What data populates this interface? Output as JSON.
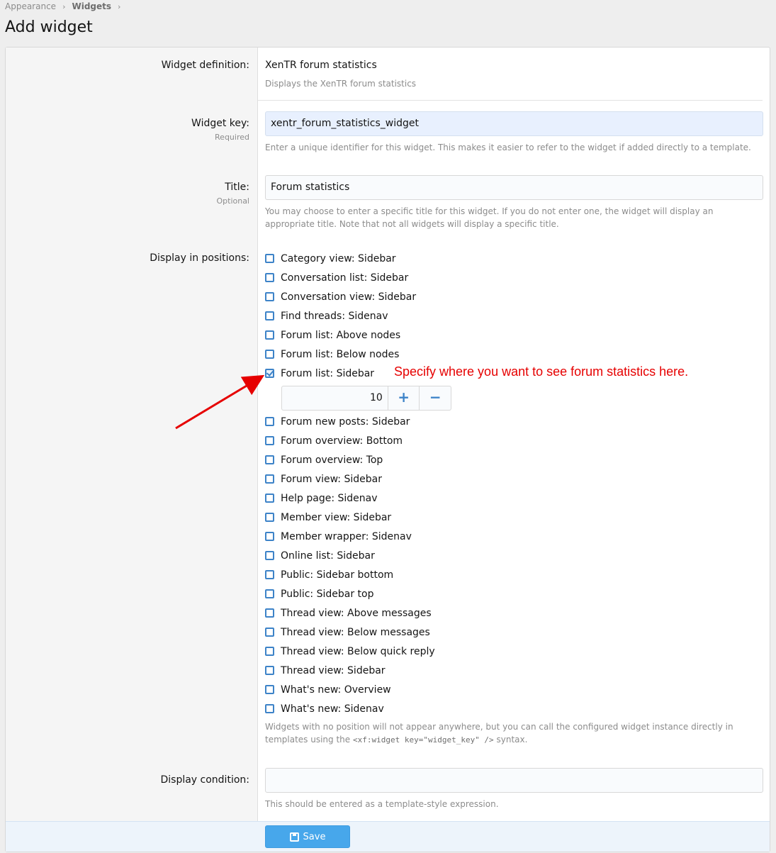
{
  "breadcrumb": {
    "items": [
      "Appearance",
      "Widgets"
    ],
    "separator": "›"
  },
  "page": {
    "title": "Add widget"
  },
  "form": {
    "definition": {
      "label": "Widget definition:",
      "value": "XenTR forum statistics",
      "explain": "Displays the XenTR forum statistics"
    },
    "key": {
      "label": "Widget key:",
      "hint": "Required",
      "value": "xentr_forum_statistics_widget",
      "explain": "Enter a unique identifier for this widget. This makes it easier to refer to the widget if added directly to a template."
    },
    "title": {
      "label": "Title:",
      "hint": "Optional",
      "value": "Forum statistics",
      "explain": "You may choose to enter a specific title for this widget. If you do not enter one, the widget will display an appropriate title. Note that not all widgets will display a specific title."
    },
    "positions": {
      "label": "Display in positions:",
      "items": [
        {
          "label": "Category view: Sidebar",
          "checked": false
        },
        {
          "label": "Conversation list: Sidebar",
          "checked": false
        },
        {
          "label": "Conversation view: Sidebar",
          "checked": false
        },
        {
          "label": "Find threads: Sidenav",
          "checked": false
        },
        {
          "label": "Forum list: Above nodes",
          "checked": false
        },
        {
          "label": "Forum list: Below nodes",
          "checked": false
        },
        {
          "label": "Forum list: Sidebar",
          "checked": true
        },
        {
          "label": "Forum new posts: Sidebar",
          "checked": false
        },
        {
          "label": "Forum overview: Bottom",
          "checked": false
        },
        {
          "label": "Forum overview: Top",
          "checked": false
        },
        {
          "label": "Forum view: Sidebar",
          "checked": false
        },
        {
          "label": "Help page: Sidenav",
          "checked": false
        },
        {
          "label": "Member view: Sidebar",
          "checked": false
        },
        {
          "label": "Member wrapper: Sidenav",
          "checked": false
        },
        {
          "label": "Online list: Sidebar",
          "checked": false
        },
        {
          "label": "Public: Sidebar bottom",
          "checked": false
        },
        {
          "label": "Public: Sidebar top",
          "checked": false
        },
        {
          "label": "Thread view: Above messages",
          "checked": false
        },
        {
          "label": "Thread view: Below messages",
          "checked": false
        },
        {
          "label": "Thread view: Below quick reply",
          "checked": false
        },
        {
          "label": "Thread view: Sidebar",
          "checked": false
        },
        {
          "label": "What's new: Overview",
          "checked": false
        },
        {
          "label": "What's new: Sidenav",
          "checked": false
        }
      ],
      "order_value": "10",
      "plus": "+",
      "minus": "−",
      "explain_pre": "Widgets with no position will not appear anywhere, but you can call the configured widget instance directly in templates using the",
      "explain_code": "<xf:widget key=\"widget_key\" />",
      "explain_post": "syntax."
    },
    "condition": {
      "label": "Display condition:",
      "value": "",
      "explain": "This should be entered as a template-style expression."
    }
  },
  "annotation": {
    "text": "Specify where you want to see forum statistics here.",
    "color": "#e60000"
  },
  "footer": {
    "save_label": "Save"
  },
  "colors": {
    "accent": "#47a7eb",
    "checkbox": "#3d83c8"
  }
}
